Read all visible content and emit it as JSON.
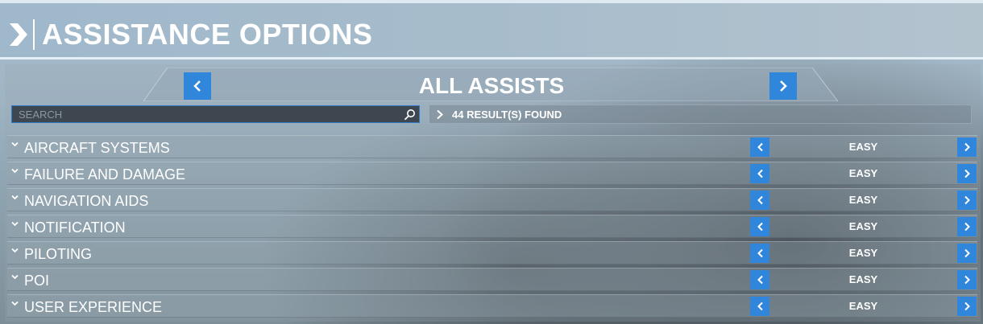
{
  "header": {
    "title": "ASSISTANCE OPTIONS"
  },
  "category": {
    "title": "ALL ASSISTS"
  },
  "search": {
    "placeholder": "SEARCH",
    "value": ""
  },
  "results": {
    "text": "44 RESULT(S) FOUND"
  },
  "rows": [
    {
      "label": "AIRCRAFT SYSTEMS",
      "value": "EASY"
    },
    {
      "label": "FAILURE AND DAMAGE",
      "value": "EASY"
    },
    {
      "label": "NAVIGATION AIDS",
      "value": "EASY"
    },
    {
      "label": "NOTIFICATION",
      "value": "EASY"
    },
    {
      "label": "PILOTING",
      "value": "EASY"
    },
    {
      "label": "POI",
      "value": "EASY"
    },
    {
      "label": "USER EXPERIENCE",
      "value": "EASY"
    }
  ],
  "icons": {
    "header": "chevron-right-icon",
    "nav_prev": "chevron-left-icon",
    "nav_next": "chevron-right-icon",
    "search": "search-icon",
    "row_expand": "chevron-down-icon"
  },
  "colors": {
    "accent": "#2f86db",
    "text": "#ffffff",
    "search_bg": "#3e4650"
  }
}
